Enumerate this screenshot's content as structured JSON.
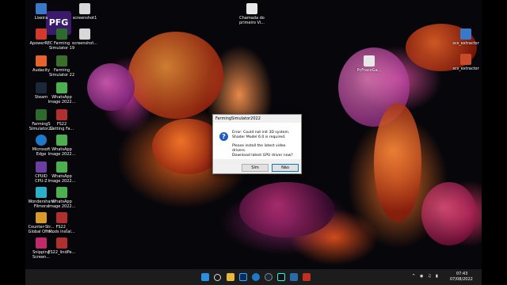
{
  "desktop": {
    "icons": [
      {
        "label": "Lixeira",
        "color": "#3a78c8"
      },
      {
        "label": "screenshot1",
        "color": "#d8d8d8"
      },
      {
        "label": "ApowerREC",
        "color": "#d33a2c"
      },
      {
        "label": "Farming\nSimulator 19",
        "color": "#2d6b2d"
      },
      {
        "label": "screenshot...",
        "color": "#d8d8d8"
      },
      {
        "label": "Audacity",
        "color": "#e8632a"
      },
      {
        "label": "Farming\nSimulator 22",
        "color": "#3a6e2b"
      },
      {
        "label": "Steam",
        "color": "#1b2838"
      },
      {
        "label": "WhatsApp\nImage 2022...",
        "color": "#4caf50"
      },
      {
        "label": "FarmingS\nSimulator22",
        "color": "#2d6b2d"
      },
      {
        "label": "FS22\nGetting Fa...",
        "color": "#b03030"
      },
      {
        "label": "Microsoft\nEdge",
        "color": "#1e7ac8"
      },
      {
        "label": "WhatsApp\nImage 2022...",
        "color": "#4caf50"
      },
      {
        "label": "CPUID\nCPU-Z",
        "color": "#6b3fa0"
      },
      {
        "label": "WhatsApp\nImage 2022...",
        "color": "#4caf50"
      },
      {
        "label": "Wondershare\nFilmora",
        "color": "#2ab0c8"
      },
      {
        "label": "WhatsApp\nImage 2022...",
        "color": "#4caf50"
      },
      {
        "label": "Counter-Str...\nGlobal Offe...",
        "color": "#d89a2a"
      },
      {
        "label": "FS22_\nMods Instal...",
        "color": "#b03030"
      },
      {
        "label": "Snipping\nScreen...",
        "color": "#c02a6a"
      },
      {
        "label": "FS22_lindPe...",
        "color": "#b03030"
      },
      {
        "label": "Chamada do\nprimeiro Vi...",
        "color": "#e8e8e8"
      },
      {
        "label": "PcFracoGa...",
        "color": "#e8e8e8"
      },
      {
        "label": "scs_extractor",
        "color": "#3a78c8"
      },
      {
        "label": "scs_extractor",
        "color": "#c84a2a"
      }
    ],
    "logo_text": "PFG"
  },
  "dialog": {
    "title": "FarmingSimulator2022",
    "icon": "question-icon",
    "message_lines": [
      "Error: Could not init 3D system.",
      "Shader Model 6.0 is required.",
      "",
      "Please install the latest video drivers.",
      "Download latest GPU driver now?"
    ],
    "yes_label": "Sim",
    "no_label": "Não"
  },
  "taskbar": {
    "icons": [
      "windows-start-icon",
      "search-icon",
      "file-explorer-icon",
      "photoshop-icon",
      "edge-icon",
      "steam-icon",
      "tiktok-icon",
      "steam-icon",
      "app-icon"
    ],
    "time": "07:43",
    "date": "07/08/2022",
    "tray": [
      "chevron-up-icon",
      "network-icon",
      "volume-icon",
      "battery-icon"
    ]
  }
}
